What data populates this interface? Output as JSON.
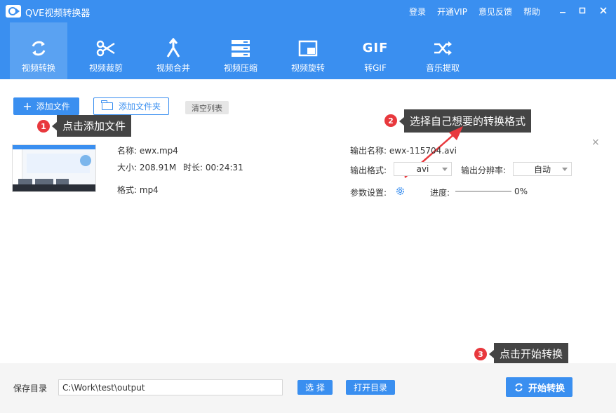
{
  "titlebar": {
    "title": "QVE视频转换器",
    "links": [
      "登录",
      "开通VIP",
      "意见反馈",
      "帮助"
    ]
  },
  "toolbar": {
    "items": [
      {
        "label": "视频转换",
        "icon": "convert-icon",
        "active": true
      },
      {
        "label": "视频裁剪",
        "icon": "scissors-icon",
        "active": false
      },
      {
        "label": "视频合并",
        "icon": "merge-icon",
        "active": false
      },
      {
        "label": "视频压缩",
        "icon": "compress-icon",
        "active": false
      },
      {
        "label": "视频旋转",
        "icon": "rotate-icon",
        "active": false
      },
      {
        "label": "转GIF",
        "icon": "gif-icon",
        "glyph": "GIF",
        "active": false
      },
      {
        "label": "音乐提取",
        "icon": "shuffle-icon",
        "active": false
      }
    ]
  },
  "actions": {
    "add_file": "添加文件",
    "add_folder": "添加文件夹",
    "clear_list": "清空列表"
  },
  "annotations": [
    {
      "num": "1",
      "text": "点击添加文件"
    },
    {
      "num": "2",
      "text": "选择自己想要的转换格式"
    },
    {
      "num": "3",
      "text": "点击开始转换"
    }
  ],
  "file": {
    "name_label": "名称:",
    "name": "ewx.mp4",
    "size_label": "大小:",
    "size": "208.91M",
    "duration_label": "时长:",
    "duration": "00:24:31",
    "format_label": "格式:",
    "format": "mp4",
    "output_name_label": "输出名称:",
    "output_name": "ewx-115704.avi",
    "output_format_label": "输出格式:",
    "output_format": "avi",
    "resolution_label": "输出分辨率:",
    "resolution": "自动",
    "params_label": "参数设置:",
    "progress_label": "进度:",
    "progress": "0%",
    "close": "×"
  },
  "bottom": {
    "save_dir_label": "保存目录",
    "save_path": "C:\\Work\\test\\output",
    "choose": "选 择",
    "open_dir": "打开目录",
    "start": "开始转换"
  },
  "colors": {
    "accent": "#3a8ff0",
    "active_tab": "#5aa2f2",
    "badge": "#e8383d",
    "tooltip": "#444444"
  }
}
